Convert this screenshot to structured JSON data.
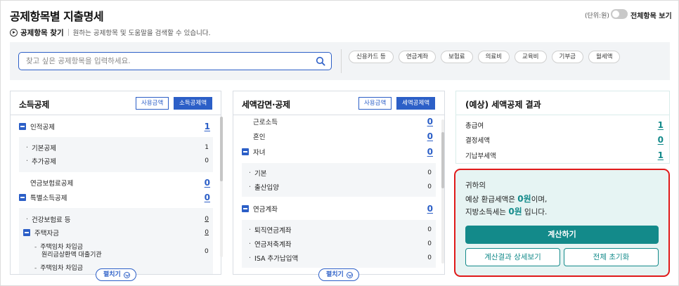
{
  "page": {
    "title": "공제항목별 지출명세",
    "unit": "(단위:원)",
    "toggle_label": "전체항목 보기"
  },
  "find": {
    "title": "공제항목 찾기",
    "desc": "원하는 공제항목 및 도움말을 검색할 수 있습니다."
  },
  "search": {
    "placeholder": "찾고 싶은 공제항목을 입력하세요.",
    "chips": [
      "신용카드 등",
      "연금계좌",
      "보험료",
      "의료비",
      "교육비",
      "기부금",
      "월세액"
    ]
  },
  "income_panel": {
    "title": "소득공제",
    "usage_label": "사용금액",
    "amount_label": "소득공제액",
    "expand_label": "펼치기",
    "personal": {
      "label": "인적공제",
      "value": "1"
    },
    "basic": {
      "label": "기본공제",
      "value": "1"
    },
    "additional": {
      "label": "추가공제",
      "value": "0"
    },
    "pension_ins": {
      "label": "연금보험료공제",
      "value": "0"
    },
    "special": {
      "label": "특별소득공제",
      "value": "0"
    },
    "health_ins": {
      "label": "건강보험료 등",
      "value": "0"
    },
    "housing": {
      "label": "주택자금",
      "value": "0"
    },
    "loan_line1": "주택임차 차입금",
    "loan_line2": "원리금상환액 대출기관",
    "loan_value": "0",
    "loan2_label": "주택임차 차입금"
  },
  "tax_panel": {
    "title": "세액감면·공제",
    "usage_label": "사용금액",
    "amount_label": "세액공제액",
    "expand_label": "펼치기",
    "earned": {
      "label": "근로소득",
      "value": "0"
    },
    "marriage": {
      "label": "혼인",
      "value": "0"
    },
    "children": {
      "label": "자녀",
      "value": "0"
    },
    "child_basic": {
      "label": "기본",
      "value": "0"
    },
    "birth": {
      "label": "출산입양",
      "value": "0"
    },
    "pension_acct": {
      "label": "연금계좌",
      "value": "0"
    },
    "retire_pension": {
      "label": "퇴직연금계좌",
      "value": "0"
    },
    "pension_savings": {
      "label": "연금저축계좌",
      "value": "0"
    },
    "isa": {
      "label": "ISA 추가납입액",
      "value": "0"
    }
  },
  "result": {
    "title": "(예상) 세액공제 결과",
    "rows": [
      {
        "label": "총급여",
        "value": "1"
      },
      {
        "label": "결정세액",
        "value": "0"
      },
      {
        "label": "기납부세액",
        "value": "1"
      }
    ],
    "line1": "귀하의",
    "line2_prefix": "예상 환급세액은 ",
    "refund": "0원",
    "line2_suffix": "이며,",
    "line3_prefix": "지방소득세는 ",
    "local_tax": "0원",
    "line3_suffix": " 입니다.",
    "calc_button": "계산하기",
    "detail_button": "계산결과 상세보기",
    "reset_button": "전체 초기화"
  },
  "colors": {
    "primary_blue": "#2c5fc7",
    "teal": "#138a8a",
    "highlight_red": "#e01a1a"
  }
}
